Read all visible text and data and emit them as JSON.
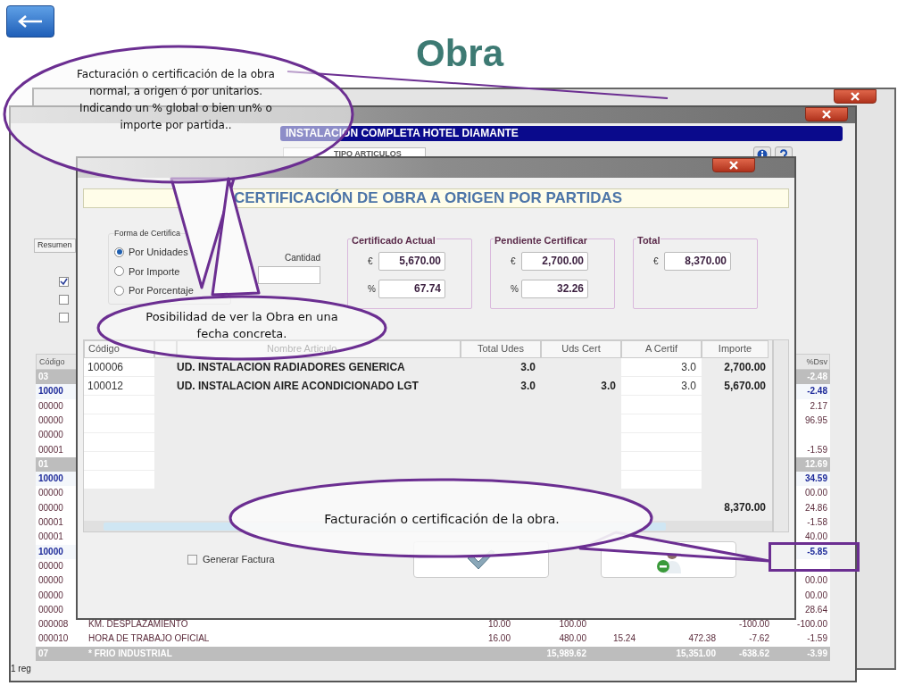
{
  "slide": {
    "title": "Obra"
  },
  "main_window": {
    "heading": "INSTALACION COMPLETA HOTEL DIAMANTE",
    "type_field": "TIPO ARTICULOS",
    "tab": "Resumen",
    "status": "1 reg",
    "checks": [
      {
        "checked": true
      },
      {
        "checked": false
      },
      {
        "checked": false
      }
    ],
    "table": {
      "columns": [
        "Código",
        null,
        null,
        null,
        null,
        null,
        null,
        "%Dsv"
      ],
      "rows": [
        {
          "kind": "group",
          "code": "03",
          "cells": [
            null,
            null,
            null,
            null,
            null,
            "-2.48"
          ]
        },
        {
          "kind": "parent",
          "code": "10000",
          "cells": [
            null,
            null,
            null,
            null,
            null,
            "-2.48"
          ]
        },
        {
          "kind": "item",
          "code": "00000",
          "cells": [
            null,
            null,
            null,
            null,
            null,
            "2.17"
          ]
        },
        {
          "kind": "item",
          "code": "00000",
          "cells": [
            null,
            null,
            null,
            null,
            null,
            "96.95"
          ]
        },
        {
          "kind": "item",
          "code": "00000",
          "cells": [
            null,
            null,
            null,
            null,
            null,
            null
          ]
        },
        {
          "kind": "item",
          "code": "00001",
          "cells": [
            null,
            null,
            null,
            null,
            null,
            "-1.59"
          ]
        },
        {
          "kind": "group",
          "code": "01",
          "cells": [
            null,
            null,
            null,
            null,
            null,
            "12.69"
          ]
        },
        {
          "kind": "parent",
          "code": "10000",
          "cells": [
            null,
            null,
            null,
            null,
            null,
            "34.59"
          ]
        },
        {
          "kind": "item",
          "code": "00000",
          "cells": [
            null,
            null,
            null,
            null,
            null,
            "00.00"
          ]
        },
        {
          "kind": "item",
          "code": "00000",
          "cells": [
            null,
            null,
            null,
            null,
            null,
            "24.86"
          ]
        },
        {
          "kind": "item",
          "code": "00001",
          "cells": [
            null,
            null,
            null,
            null,
            null,
            "-1.58"
          ]
        },
        {
          "kind": "item",
          "code": "00001",
          "cells": [
            null,
            null,
            null,
            null,
            null,
            "40.00"
          ]
        },
        {
          "kind": "parent",
          "code": "10000",
          "cells": [
            null,
            null,
            null,
            null,
            null,
            "-5.85"
          ]
        },
        {
          "kind": "item",
          "code": "00000",
          "cells": [
            null,
            null,
            null,
            null,
            null,
            null
          ]
        },
        {
          "kind": "item",
          "code": "00000",
          "cells": [
            null,
            null,
            null,
            null,
            null,
            "00.00"
          ]
        },
        {
          "kind": "item",
          "code": "00000",
          "cells": [
            null,
            null,
            null,
            null,
            null,
            "00.00"
          ]
        },
        {
          "kind": "item",
          "code": "00000",
          "cells": [
            null,
            null,
            null,
            null,
            null,
            "28.64"
          ]
        },
        {
          "kind": "item",
          "code": "000008",
          "name": "KM. DESPLAZAMIENTO",
          "cells": [
            "10.00",
            "100.00",
            null,
            null,
            "-100.00",
            "-100.00"
          ]
        },
        {
          "kind": "item",
          "code": "000010",
          "name": "HORA DE TRABAJO OFICIAL",
          "cells": [
            "16.00",
            "480.00",
            "15.24",
            "472.38",
            "-7.62",
            "-1.59"
          ]
        },
        {
          "kind": "group",
          "code": "07",
          "name": "* FRIO INDUSTRIAL",
          "cells": [
            null,
            "15,989.62",
            null,
            "15,351.00",
            "-638.62",
            "-3.99"
          ]
        }
      ]
    }
  },
  "dialog": {
    "heading": "CERTIFICACIÓN DE OBRA A ORIGEN POR PARTIDAS",
    "mode_group": {
      "label": "Forma de Certifica",
      "options": [
        {
          "label": "Por Unidades",
          "selected": true
        },
        {
          "label": "Por Importe",
          "selected": false
        },
        {
          "label": "Por Porcentaje",
          "selected": false
        }
      ]
    },
    "quantity_label": "Cantidad",
    "summaries": [
      {
        "label": "Certificado Actual",
        "fields": [
          {
            "unit": "€",
            "value": "5,670.00"
          },
          {
            "unit": "%",
            "value": "67.74"
          }
        ]
      },
      {
        "label": "Pendiente Certificar",
        "fields": [
          {
            "unit": "€",
            "value": "2,700.00"
          },
          {
            "unit": "%",
            "value": "32.26"
          }
        ]
      },
      {
        "label": "Total",
        "fields": [
          {
            "unit": "€",
            "value": "8,370.00"
          }
        ]
      }
    ],
    "table": {
      "columns": [
        "Código",
        "Nombre Articulo",
        "Total Udes",
        "Uds Cert",
        "A Certif",
        "Importe"
      ],
      "rows": [
        {
          "code": "100006",
          "name": "UD. INSTALACION RADIADORES GENERICA",
          "total": "3.0",
          "cert": "3.0",
          "amount": "2,700.00"
        },
        {
          "code": "100012",
          "name": "UD. INSTALACION AIRE ACONDICIONADO LGT",
          "total": "3.0",
          "done": "3.0",
          "cert": "3.0",
          "amount": "5,670.00"
        }
      ],
      "sum": "8,370.00"
    },
    "invoice": {
      "label": "Generar Factura",
      "checked": false
    }
  },
  "callouts": [
    "Facturación o certificación de la obra normal, a origen ó por unitarios. Indicando un % global o bien un% o importe por partida..",
    "Posibilidad de ver la Obra en una fecha concreta.",
    "Facturación o certificación de la obra."
  ]
}
